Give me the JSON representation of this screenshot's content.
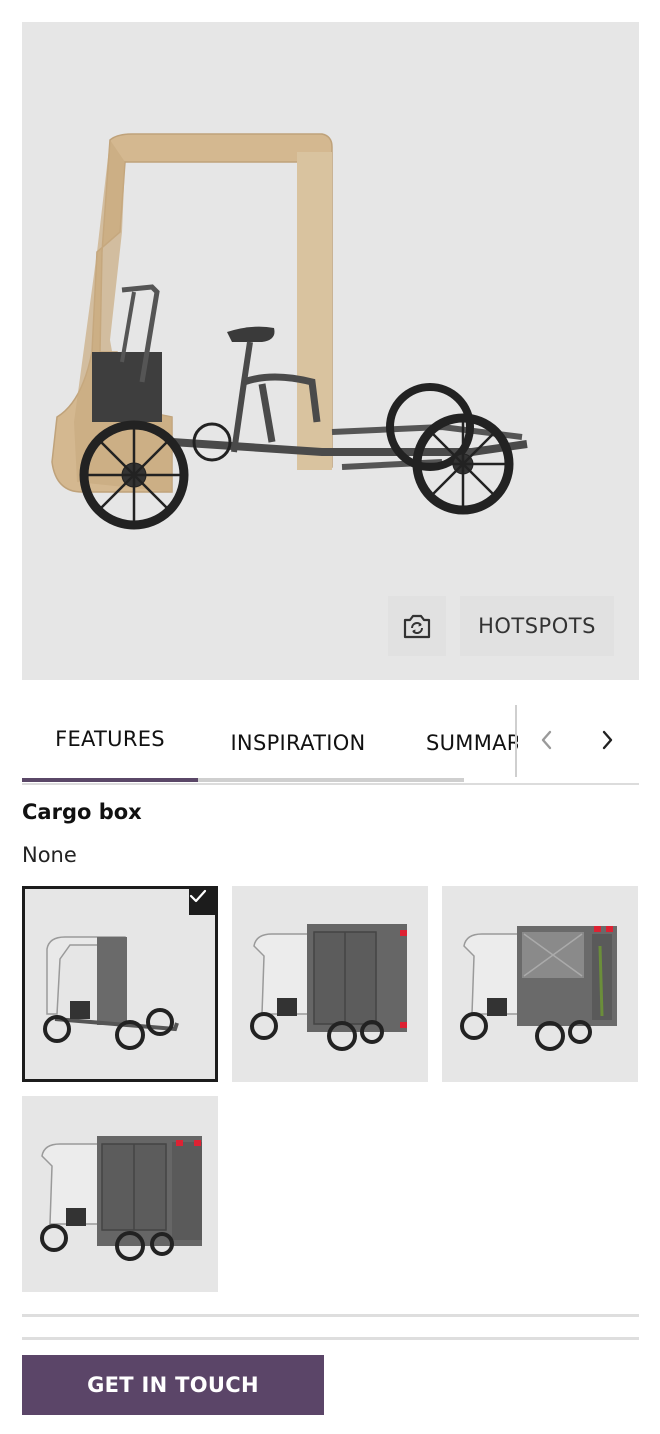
{
  "viewer": {
    "snapshot_icon": "camera-rotate-icon",
    "hotspots_label": "HOTSPOTS"
  },
  "tabs": {
    "items": [
      {
        "label": "FEATURES",
        "active": true
      },
      {
        "label": "INSPIRATION",
        "active": false
      },
      {
        "label": "SUMMARY",
        "active": false
      }
    ],
    "prev_icon": "chevron-left-icon",
    "next_icon": "chevron-right-icon"
  },
  "feature": {
    "title": "Cargo box",
    "value": "None"
  },
  "options": [
    {
      "name": "no-box",
      "selected": true
    },
    {
      "name": "closed-box-doors",
      "selected": false
    },
    {
      "name": "open-mesh-box",
      "selected": false
    },
    {
      "name": "closed-box-slim",
      "selected": false
    }
  ],
  "cta": {
    "label": "GET IN TOUCH"
  },
  "colors": {
    "accent": "#5b4568",
    "canopy": "#d4b890",
    "frame": "#4a4a4a",
    "viewer_bg": "#e6e6e6"
  }
}
